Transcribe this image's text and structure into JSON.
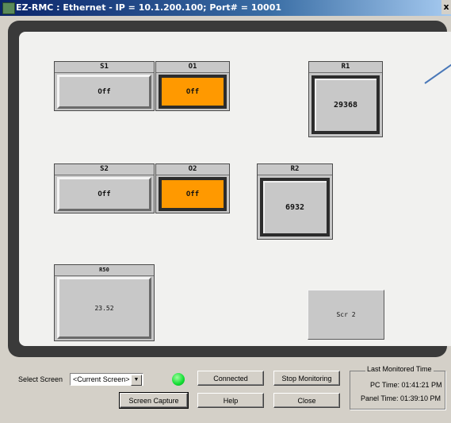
{
  "window": {
    "title": "EZ-RMC : Ethernet - IP = 10.1.200.100; Port# = 10001",
    "close_glyph": "x"
  },
  "panel": {
    "tiles": {
      "s1": {
        "header": "S1",
        "value": "Off"
      },
      "o1": {
        "header": "O1",
        "value": "Off"
      },
      "r1": {
        "header": "R1",
        "value": "29368"
      },
      "s2": {
        "header": "S2",
        "value": "Off"
      },
      "o2": {
        "header": "O2",
        "value": "Off"
      },
      "r2": {
        "header": "R2",
        "value": "6932"
      },
      "r50": {
        "header": "R50",
        "value": "23.52"
      },
      "scr2": {
        "value": "Scr 2"
      }
    },
    "colors": {
      "output_on": "#ff9900",
      "frame": "#3a3a3a",
      "screen_bg": "#f1f1ef"
    }
  },
  "controls": {
    "select_screen_label": "Select Screen",
    "select_screen_value": "<Current Screen>",
    "connection_status": "Connected",
    "status_led_color": "#11dd33",
    "stop_monitoring": "Stop Monitoring",
    "screen_capture": "Screen Capture",
    "help": "Help",
    "close": "Close",
    "last_monitored": {
      "title": "Last Monitored Time",
      "pc_time": "PC Time:  01:41:21 PM",
      "panel_time": "Panel Time:  01:39:10 PM"
    }
  }
}
